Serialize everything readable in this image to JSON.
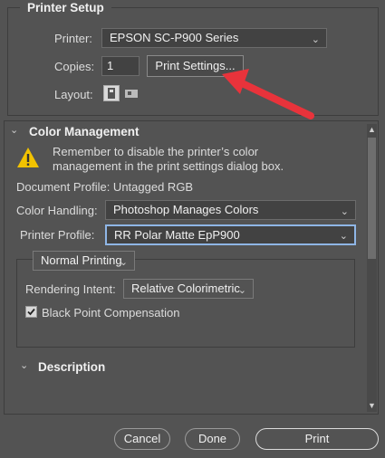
{
  "printer_setup": {
    "title": "Printer Setup",
    "printer_label": "Printer:",
    "printer_value": "EPSON SC-P900 Series",
    "copies_label": "Copies:",
    "copies_value": "1",
    "print_settings_label": "Print Settings...",
    "layout_label": "Layout:"
  },
  "color_management": {
    "title": "Color Management",
    "warning_text_line1": "Remember to disable the printer’s color",
    "warning_text_line2": "management in the print settings dialog box.",
    "document_profile": "Document Profile: Untagged RGB",
    "color_handling_label": "Color Handling:",
    "color_handling_value": "Photoshop Manages Colors",
    "printer_profile_label": "Printer Profile:",
    "printer_profile_value": "RR Polar Matte EpP900",
    "printing_mode_value": "Normal Printing",
    "rendering_intent_label": "Rendering Intent:",
    "rendering_intent_value": "Relative Colorimetric",
    "bpc_label": "Black Point Compensation",
    "bpc_checked": true
  },
  "description": {
    "title": "Description"
  },
  "footer": {
    "cancel_label": "Cancel",
    "done_label": "Done",
    "print_label": "Print"
  },
  "colors": {
    "background": "#535353",
    "annotation_arrow": "#e8333b",
    "focus_border": "#8fb6e6",
    "warning_yellow": "#f2c200"
  }
}
